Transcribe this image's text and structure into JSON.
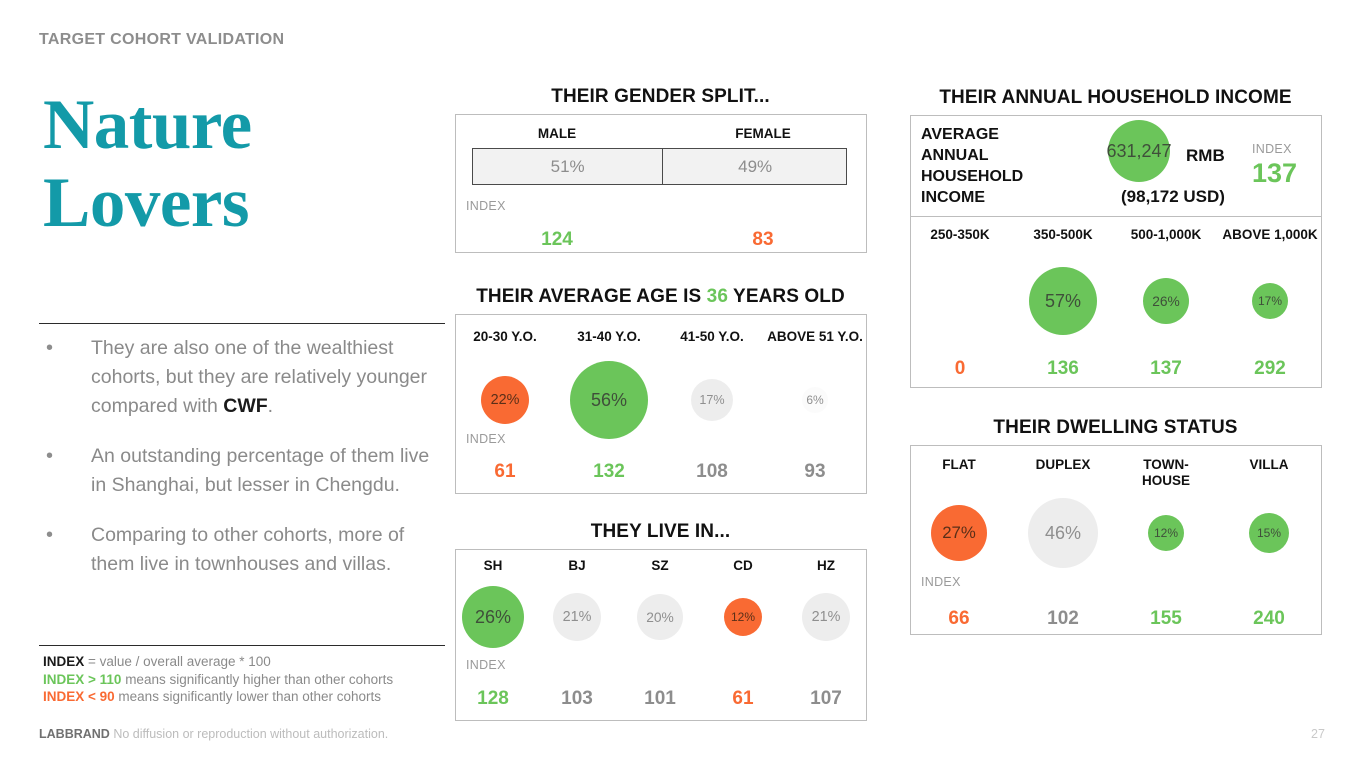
{
  "header": {
    "kicker": "TARGET COHORT VALIDATION"
  },
  "cohort": {
    "title_line1": "Nature",
    "title_line2": "Lovers"
  },
  "bullets": [
    {
      "bullet": "•",
      "text_before": "They are also one of the wealthiest cohorts, but they are relatively younger compared with ",
      "bold": "CWF",
      "text_after": "."
    },
    {
      "bullet": "•",
      "text_before": "An outstanding percentage of them live in Shanghai, but lesser in Chengdu.",
      "bold": "",
      "text_after": ""
    },
    {
      "bullet": "•",
      "text_before": "Comparing to other cohorts, more of them live in townhouses and villas.",
      "bold": "",
      "text_after": ""
    }
  ],
  "legend": {
    "line1_key": "INDEX",
    "line1_rest": " = value / overall average * 100",
    "line2_key": "INDEX > 110",
    "line2_rest": " means significantly higher than other cohorts",
    "line3_key": "INDEX < 90",
    "line3_rest": " means significantly lower than other cohorts"
  },
  "footer": {
    "brand": "LABBRAND",
    "note": "No diffusion or reproduction without authorization.",
    "page": "27"
  },
  "index_label": "INDEX",
  "colors": {
    "teal": "#139aa8",
    "green": "#6bc55a",
    "orange": "#f96a33",
    "grey": "#8d8d8d",
    "light_grey": "#ededed"
  },
  "chart_data": [
    {
      "type": "bar",
      "title": "THEIR GENDER SPLIT...",
      "categories": [
        "MALE",
        "FEMALE"
      ],
      "values": [
        "51%",
        "49%"
      ],
      "index_label": "INDEX",
      "index": [
        "124",
        "83"
      ],
      "index_tone": [
        "green",
        "orange"
      ],
      "ylabel": "",
      "xlabel": ""
    },
    {
      "type": "bubble",
      "title_before": "THEIR AVERAGE AGE IS ",
      "title_highlight": "36",
      "title_after": " YEARS OLD",
      "categories": [
        "20-30 Y.O.",
        "31-40 Y.O.",
        "41-50 Y.O.",
        "ABOVE 51 Y.O."
      ],
      "values": [
        "22%",
        "56%",
        "17%",
        "6%"
      ],
      "numeric": [
        22,
        56,
        17,
        6
      ],
      "tone": [
        "orange",
        "green",
        "grey",
        "faint"
      ],
      "index_label": "INDEX",
      "index": [
        "61",
        "132",
        "108",
        "93"
      ],
      "index_tone": [
        "orange",
        "green",
        "grey",
        "grey"
      ]
    },
    {
      "type": "bubble",
      "title": "THEY LIVE IN...",
      "categories": [
        "SH",
        "BJ",
        "SZ",
        "CD",
        "HZ"
      ],
      "values": [
        "26%",
        "21%",
        "20%",
        "12%",
        "21%"
      ],
      "numeric": [
        26,
        21,
        20,
        12,
        21
      ],
      "tone": [
        "green",
        "grey",
        "grey",
        "orange",
        "grey"
      ],
      "index_label": "INDEX",
      "index": [
        "128",
        "103",
        "101",
        "61",
        "107"
      ],
      "index_tone": [
        "green",
        "grey",
        "grey",
        "orange",
        "grey"
      ]
    },
    {
      "type": "bubble",
      "title": "THEIR ANNUAL HOUSEHOLD INCOME",
      "summary": {
        "label": "AVERAGE ANNUAL HOUSEHOLD INCOME",
        "label_lines": [
          "AVERAGE",
          "ANNUAL",
          "HOUSEHOLD",
          "INCOME"
        ],
        "amount": "631,247",
        "currency": "RMB",
        "usd": "(98,172 USD)",
        "index_label": "INDEX",
        "index": "137"
      },
      "categories": [
        "250-350K",
        "350-500K",
        "500-1,000K",
        "ABOVE 1,000K"
      ],
      "values": [
        "",
        "57%",
        "26%",
        "17%"
      ],
      "numeric": [
        0,
        57,
        26,
        17
      ],
      "tone": [
        "none",
        "green",
        "green",
        "green"
      ],
      "index": [
        "0",
        "136",
        "137",
        "292"
      ],
      "index_tone": [
        "orange",
        "green",
        "green",
        "green"
      ]
    },
    {
      "type": "bubble",
      "title": "THEIR DWELLING STATUS",
      "categories": [
        "FLAT",
        "DUPLEX",
        "TOWN-\nHOUSE",
        "VILLA"
      ],
      "category_lines": [
        [
          "FLAT"
        ],
        [
          "DUPLEX"
        ],
        [
          "TOWN-",
          "HOUSE"
        ],
        [
          "VILLA"
        ]
      ],
      "values": [
        "27%",
        "46%",
        "12%",
        "15%"
      ],
      "numeric": [
        27,
        46,
        12,
        15
      ],
      "tone": [
        "orange",
        "grey",
        "green",
        "green"
      ],
      "index_label": "INDEX",
      "index": [
        "66",
        "102",
        "155",
        "240"
      ],
      "index_tone": [
        "orange",
        "grey",
        "green",
        "green"
      ]
    }
  ]
}
